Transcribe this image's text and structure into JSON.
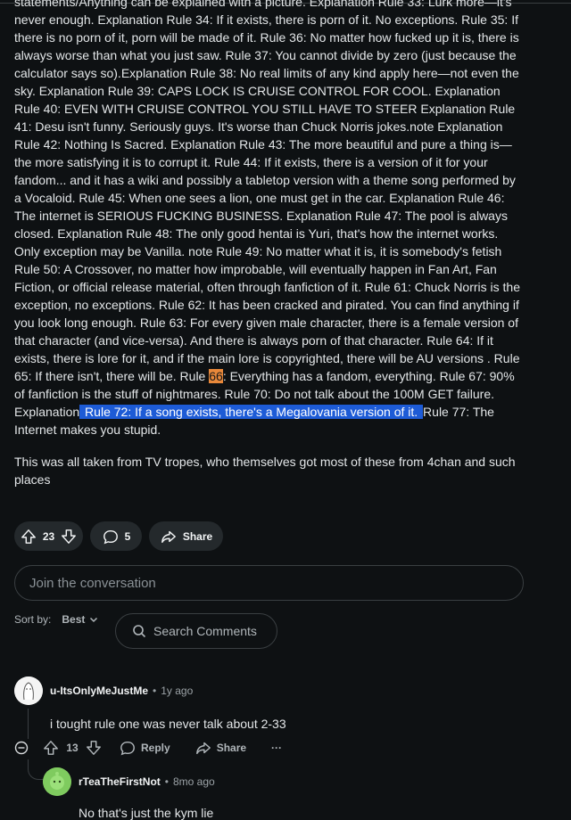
{
  "post": {
    "paragraph1_a": "statements/Anything can be explained with a picture. Explanation Rule 33: Lurk more—it's never enough. Explanation Rule 34: If it exists, there is porn of it. No exceptions. Rule 35: If there is no porn of it, porn will be made of it. Rule 36: No matter how fucked up it is, there is always worse than what you just saw. Rule 37: You cannot divide by zero (just because the calculator says so).Explanation Rule 38: No real limits of any kind apply here—not even the sky. Explanation Rule 39: CAPS LOCK IS CRUISE CONTROL FOR COOL. Explanation Rule 40: EVEN WITH CRUISE CONTROL YOU STILL HAVE TO STEER Explanation Rule 41: Desu isn't funny. Seriously guys. It's worse than Chuck Norris jokes.note Explanation Rule 42: Nothing Is Sacred. Explanation Rule 43: The more beautiful and pure a thing is—the more satisfying it is to corrupt it. Rule 44: If it exists, there is a version of it for your fandom... and it has a wiki and possibly a tabletop version with a theme song performed by a Vocaloid. Rule 45: When one sees a lion, one must get in the car. Explanation Rule 46: The internet is SERIOUS FUCKING BUSINESS. Explanation Rule 47: The pool is always closed. Explanation Rule 48: The only good hentai is Yuri, that's how the internet works. Only exception may be Vanilla. note Rule 49: No matter what it is, it is somebody's fetish Rule 50: A Crossover, no matter how improbable, will eventually happen in Fan Art, Fan Fiction, or official release material, often through fanfiction of it. Rule 61: Chuck Norris is the exception, no exceptions. Rule 62: It has been cracked and pirated. You can find anything if you look long enough. Rule 63: For every given male character, there is a female version of that character (and vice-versa). And there is always porn of that character. Rule 64: If it exists, there is lore for it, and if the main lore is copyrighted, there will be AU versions . Rule 65: If there isn't, there will be. Rule ",
    "highlight_num": "66",
    "paragraph1_b": ": Everything has a fandom, everything. Rule 67: 90% of fanfiction is the stuff of nightmares. Rule 70: Do not talk about the 100M GET failure. Explanation",
    "highlight_sel": " Rule 72: If a song exists, there's a Megalovania version of it. ",
    "paragraph1_c": "Rule 77: The Internet makes you stupid.",
    "paragraph2": "This was all taken from TV tropes, who themselves got most of these from 4chan and such places"
  },
  "actions": {
    "votes": "23",
    "comments": "5",
    "share_label": "Share"
  },
  "join": {
    "placeholder": "Join the conversation"
  },
  "sort": {
    "label": "Sort by:",
    "value": "Best"
  },
  "search": {
    "placeholder": "Search Comments"
  },
  "comments": [
    {
      "author": "u-ItsOnlyMeJustMe",
      "time": "1y ago",
      "text": "i tought rule one was never talk about 2-33",
      "votes": "13",
      "reply_label": "Reply",
      "share_label": "Share",
      "more_label": "···"
    },
    {
      "author": "rTeaTheFirstNot",
      "time": "8mo ago",
      "text": "No that's just the kym lie"
    }
  ],
  "colors": {
    "background": "#0e1113",
    "highlight_orange": "#e8883a",
    "highlight_blue": "#1d5bd6"
  }
}
